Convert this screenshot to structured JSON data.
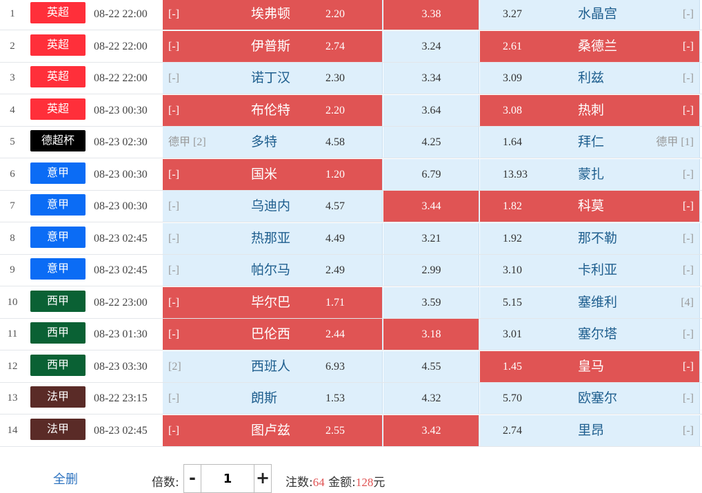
{
  "colors": {
    "selected": "#e05454",
    "unselected": "#deeffb",
    "league_epl": "#ff2f3a",
    "league_supercup": "#000000",
    "league_seriea": "#0b6cf5",
    "league_laliga": "#0a6134",
    "league_ligue1": "#5a2b27"
  },
  "matches": [
    {
      "num": "1",
      "league": "英超",
      "league_color": "#ff2f3a",
      "time": "08-22 22:00",
      "home_rank": "[-]",
      "home": "埃弗顿",
      "odd_win": "2.20",
      "odd_draw": "3.38",
      "odd_lose": "3.27",
      "away": "水晶宫",
      "away_rank": "[-]",
      "sel": [
        true,
        true,
        false
      ]
    },
    {
      "num": "2",
      "league": "英超",
      "league_color": "#ff2f3a",
      "time": "08-22 22:00",
      "home_rank": "[-]",
      "home": "伊普斯",
      "odd_win": "2.74",
      "odd_draw": "3.24",
      "odd_lose": "2.61",
      "away": "桑德兰",
      "away_rank": "[-]",
      "sel": [
        true,
        false,
        true
      ]
    },
    {
      "num": "3",
      "league": "英超",
      "league_color": "#ff2f3a",
      "time": "08-22 22:00",
      "home_rank": "[-]",
      "home": "诺丁汉",
      "odd_win": "2.30",
      "odd_draw": "3.34",
      "odd_lose": "3.09",
      "away": "利兹",
      "away_rank": "[-]",
      "sel": [
        false,
        false,
        false
      ]
    },
    {
      "num": "4",
      "league": "英超",
      "league_color": "#ff2f3a",
      "time": "08-23 00:30",
      "home_rank": "[-]",
      "home": "布伦特",
      "odd_win": "2.20",
      "odd_draw": "3.64",
      "odd_lose": "3.08",
      "away": "热刺",
      "away_rank": "[-]",
      "sel": [
        true,
        false,
        true
      ]
    },
    {
      "num": "5",
      "league": "德超杯",
      "league_color": "#000000",
      "time": "08-23 02:30",
      "home_rank": "德甲 [2]",
      "home": "多特",
      "odd_win": "4.58",
      "odd_draw": "4.25",
      "odd_lose": "1.64",
      "away": "拜仁",
      "away_rank": "德甲 [1]",
      "sel": [
        false,
        false,
        false
      ]
    },
    {
      "num": "6",
      "league": "意甲",
      "league_color": "#0b6cf5",
      "time": "08-23 00:30",
      "home_rank": "[-]",
      "home": "国米",
      "odd_win": "1.20",
      "odd_draw": "6.79",
      "odd_lose": "13.93",
      "away": "蒙扎",
      "away_rank": "[-]",
      "sel": [
        true,
        false,
        false
      ]
    },
    {
      "num": "7",
      "league": "意甲",
      "league_color": "#0b6cf5",
      "time": "08-23 00:30",
      "home_rank": "[-]",
      "home": "乌迪内",
      "odd_win": "4.57",
      "odd_draw": "3.44",
      "odd_lose": "1.82",
      "away": "科莫",
      "away_rank": "[-]",
      "sel": [
        false,
        true,
        true
      ]
    },
    {
      "num": "8",
      "league": "意甲",
      "league_color": "#0b6cf5",
      "time": "08-23 02:45",
      "home_rank": "[-]",
      "home": "热那亚",
      "odd_win": "4.49",
      "odd_draw": "3.21",
      "odd_lose": "1.92",
      "away": "那不勒",
      "away_rank": "[-]",
      "sel": [
        false,
        false,
        false
      ]
    },
    {
      "num": "9",
      "league": "意甲",
      "league_color": "#0b6cf5",
      "time": "08-23 02:45",
      "home_rank": "[-]",
      "home": "帕尔马",
      "odd_win": "2.49",
      "odd_draw": "2.99",
      "odd_lose": "3.10",
      "away": "卡利亚",
      "away_rank": "[-]",
      "sel": [
        false,
        false,
        false
      ]
    },
    {
      "num": "10",
      "league": "西甲",
      "league_color": "#0a6134",
      "time": "08-22 23:00",
      "home_rank": "[-]",
      "home": "毕尔巴",
      "odd_win": "1.71",
      "odd_draw": "3.59",
      "odd_lose": "5.15",
      "away": "塞维利",
      "away_rank": "[4]",
      "sel": [
        true,
        false,
        false
      ]
    },
    {
      "num": "11",
      "league": "西甲",
      "league_color": "#0a6134",
      "time": "08-23 01:30",
      "home_rank": "[-]",
      "home": "巴伦西",
      "odd_win": "2.44",
      "odd_draw": "3.18",
      "odd_lose": "3.01",
      "away": "塞尔塔",
      "away_rank": "[-]",
      "sel": [
        true,
        true,
        false
      ]
    },
    {
      "num": "12",
      "league": "西甲",
      "league_color": "#0a6134",
      "time": "08-23 03:30",
      "home_rank": "[2]",
      "home": "西班人",
      "odd_win": "6.93",
      "odd_draw": "4.55",
      "odd_lose": "1.45",
      "away": "皇马",
      "away_rank": "[-]",
      "sel": [
        false,
        false,
        true
      ]
    },
    {
      "num": "13",
      "league": "法甲",
      "league_color": "#5a2b27",
      "time": "08-22 23:15",
      "home_rank": "[-]",
      "home": "朗斯",
      "odd_win": "1.53",
      "odd_draw": "4.32",
      "odd_lose": "5.70",
      "away": "欧塞尔",
      "away_rank": "[-]",
      "sel": [
        false,
        false,
        false
      ]
    },
    {
      "num": "14",
      "league": "法甲",
      "league_color": "#5a2b27",
      "time": "08-23 02:45",
      "home_rank": "[-]",
      "home": "图卢兹",
      "odd_win": "2.55",
      "odd_draw": "3.42",
      "odd_lose": "2.74",
      "away": "里昂",
      "away_rank": "[-]",
      "sel": [
        true,
        true,
        false
      ]
    }
  ],
  "footer": {
    "clear_label": "全删",
    "multiplier_label": "倍数:",
    "minus": "-",
    "plus": "+",
    "multiplier_value": "1",
    "bets_label": "注数:",
    "bets_value": "64",
    "amount_label": "金额:",
    "amount_value": "128",
    "amount_unit": "元"
  }
}
